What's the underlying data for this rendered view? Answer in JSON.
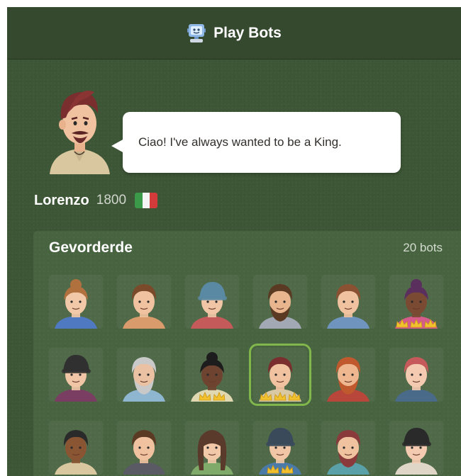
{
  "header": {
    "title": "Play Bots",
    "icon": "robot-icon"
  },
  "speaker": {
    "message": "Ciao! I've always wanted to be a King.",
    "name": "Lorenzo",
    "rating": "1800",
    "flag": "italy-flag"
  },
  "group": {
    "title": "Gevorderde",
    "count": "20 bots"
  },
  "bots": [
    {
      "skin": "#f2c9a8",
      "hair": "#b0713f",
      "shirt": "#4f7ac2",
      "style": "bun",
      "crowns": 0
    },
    {
      "skin": "#f0c29f",
      "hair": "#7a4a2a",
      "shirt": "#d99b6c",
      "style": "short",
      "crowns": 0
    },
    {
      "skin": "#f0c6a6",
      "hair": "#5a8aa3",
      "shirt": "#c45a5a",
      "style": "beanie",
      "crowns": 0
    },
    {
      "skin": "#e8b58f",
      "hair": "#5b3a24",
      "shirt": "#a3a8b5",
      "style": "beard",
      "crowns": 0
    },
    {
      "skin": "#f0c29f",
      "hair": "#8a5232",
      "shirt": "#6f95bf",
      "style": "short",
      "crowns": 0
    },
    {
      "skin": "#7a4a32",
      "hair": "#5a2f5e",
      "shirt": "#d55b8a",
      "style": "locs",
      "crowns": 3
    },
    {
      "skin": "#f0c6a6",
      "hair": "#303030",
      "shirt": "#7a3e63",
      "style": "cap",
      "crowns": 0
    },
    {
      "skin": "#eac1a2",
      "hair": "#c9c9c9",
      "shirt": "#8fb6d1",
      "style": "beard",
      "crowns": 0
    },
    {
      "skin": "#6e4430",
      "hair": "#1d1d1d",
      "shirt": "#e0d8b0",
      "style": "bun",
      "crowns": 2
    },
    {
      "skin": "#f0c29f",
      "hair": "#7a2e2e",
      "shirt": "#d8c9a4",
      "style": "short",
      "crowns": 3
    },
    {
      "skin": "#efb790",
      "hair": "#c05a2e",
      "shirt": "#b8463a",
      "style": "beard",
      "crowns": 0
    },
    {
      "skin": "#f4cbb0",
      "hair": "#c65a5a",
      "shirt": "#4a6a8a",
      "style": "short",
      "crowns": 0
    },
    {
      "skin": "#8a5533",
      "hair": "#2a2a2a",
      "shirt": "#d9c7a0",
      "style": "short",
      "crowns": 0
    },
    {
      "skin": "#f0c29f",
      "hair": "#5b3a24",
      "shirt": "#5a5a64",
      "style": "short",
      "crowns": 0
    },
    {
      "skin": "#f2c9a8",
      "hair": "#5a3a2a",
      "shirt": "#7faa6a",
      "style": "long",
      "crowns": 0
    },
    {
      "skin": "#f0c6a6",
      "hair": "#3a4a5a",
      "shirt": "#4a7aa8",
      "style": "beanie",
      "crowns": 2
    },
    {
      "skin": "#f0c29f",
      "hair": "#8a3a3a",
      "shirt": "#5aa0a8",
      "style": "beard",
      "crowns": 0
    },
    {
      "skin": "#f4cbb0",
      "hair": "#2a2a2a",
      "shirt": "#e0d6c8",
      "style": "hat",
      "crowns": 0
    }
  ],
  "selected_index": 9,
  "colors": {
    "background": "#3d5636",
    "header": "#35492f",
    "group": "#476340",
    "accent": "#81b64c",
    "crown": "#f2c12e"
  }
}
